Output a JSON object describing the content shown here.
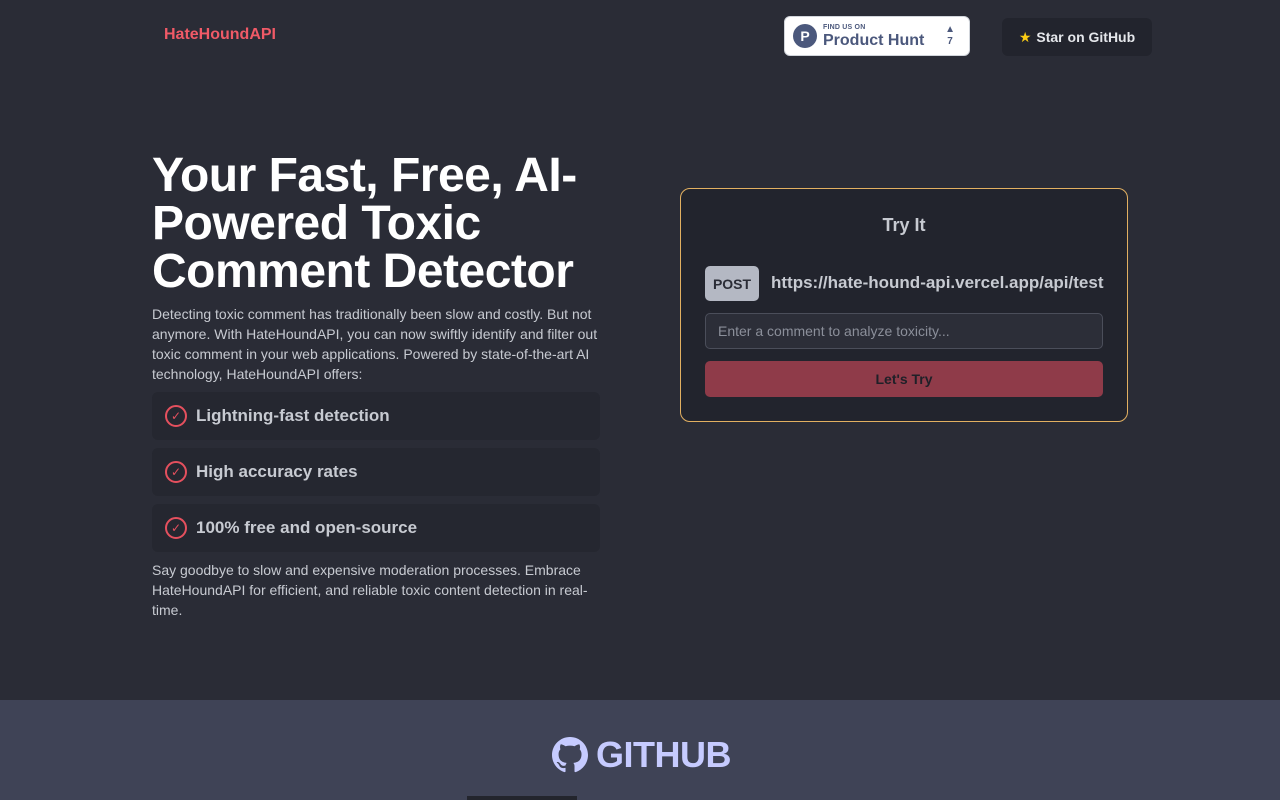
{
  "header": {
    "brand": "HateHoundAPI",
    "product_hunt": {
      "small_text": "FIND US ON",
      "big_text": "Product Hunt",
      "logo_letter": "P",
      "vote_count": "7"
    },
    "github_star_label": "Star on GitHub"
  },
  "hero": {
    "title": "Your Fast, Free, AI-Powered Toxic Comment Detector",
    "description": "Detecting toxic comment has traditionally been slow and costly. But not anymore. With HateHoundAPI, you can now swiftly identify and filter out toxic comment in your web applications. Powered by state-of-the-art AI technology, HateHoundAPI offers:",
    "features": [
      {
        "label": "Lightning-fast detection"
      },
      {
        "label": "High accuracy rates"
      },
      {
        "label": "100% free and open-source"
      }
    ],
    "outro": "Say goodbye to slow and expensive moderation processes. Embrace HateHoundAPI for efficient, and reliable toxic content detection in real-time."
  },
  "try_it": {
    "title": "Try It",
    "method": "POST",
    "endpoint": "https://hate-hound-api.vercel.app/api/test",
    "input_placeholder": "Enter a comment to analyze toxicity...",
    "input_value": "",
    "button_label": "Let's Try"
  },
  "github_section": {
    "heading": "GITHUB"
  },
  "colors": {
    "brand": "#f05a67",
    "card_border": "#e2b061",
    "button_bg": "#8f3b49",
    "page_bg": "#2a2c36"
  }
}
